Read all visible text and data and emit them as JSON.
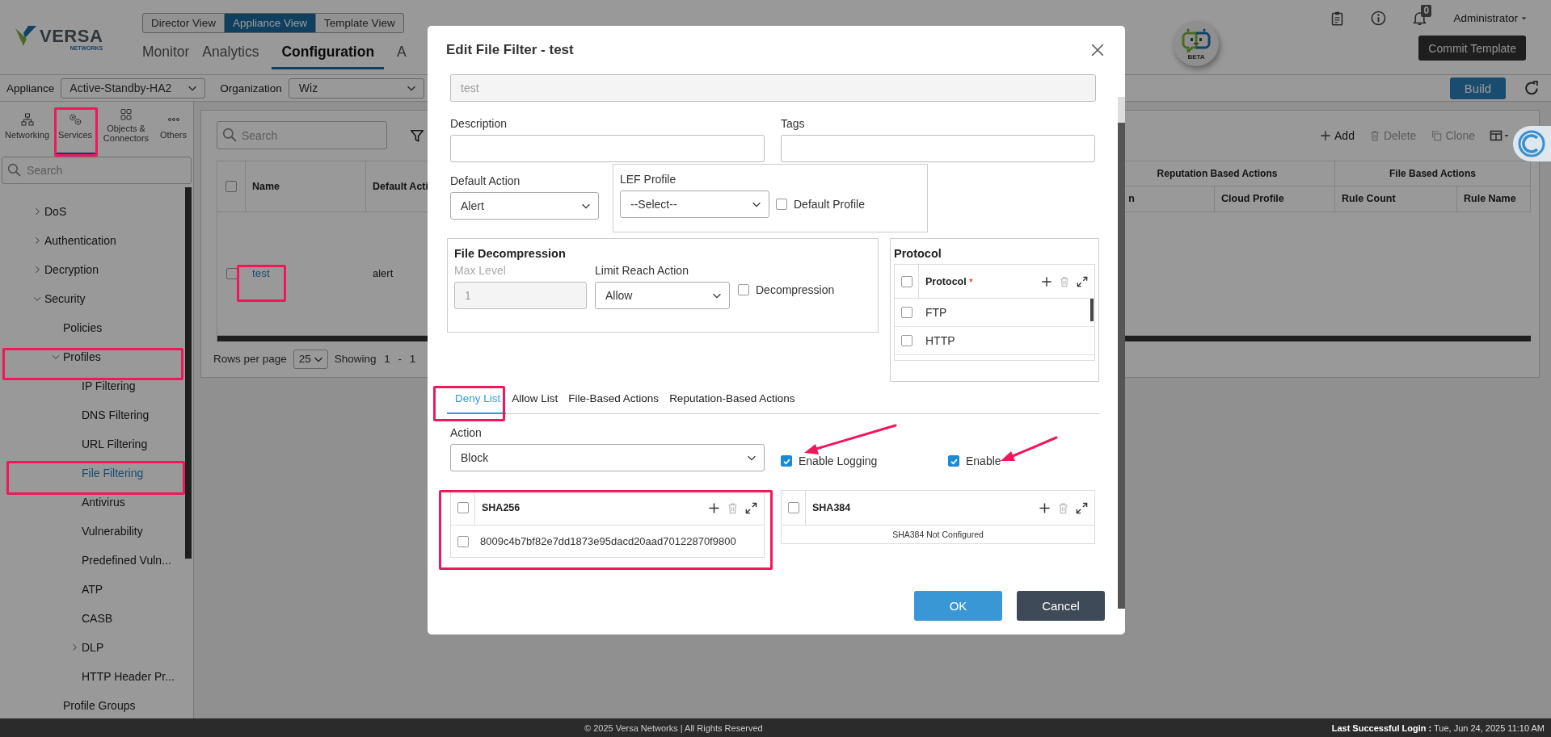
{
  "header": {
    "logo_text": "VERSA",
    "logo_subtext": "NETWORKS",
    "views": [
      {
        "label": "Director View",
        "selected": false
      },
      {
        "label": "Appliance View",
        "selected": true
      },
      {
        "label": "Template View",
        "selected": false
      }
    ],
    "nav": [
      {
        "label": "Monitor",
        "selected": false
      },
      {
        "label": "Analytics",
        "selected": false
      },
      {
        "label": "Configuration",
        "selected": true
      },
      {
        "label": "A",
        "selected": false
      }
    ],
    "beta_label": "BETA",
    "notification_count": "0",
    "user": "Administrator",
    "commit_button": "Commit Template"
  },
  "context_bar": {
    "appliance_label": "Appliance",
    "appliance": "Active-Standby-HA2",
    "organization_label": "Organization",
    "organization": "Wiz",
    "build_button": "Build"
  },
  "sidebar": {
    "tabs": [
      {
        "label": "Networking",
        "selected": false
      },
      {
        "label": "Services",
        "selected": true
      },
      {
        "label": "Objects & Connectors",
        "selected": false
      },
      {
        "label": "Others",
        "selected": false
      }
    ],
    "search_placeholder": "Search",
    "tree": [
      {
        "label": "DoS",
        "kind": "group",
        "expanded": false,
        "selected": false
      },
      {
        "label": "Authentication",
        "kind": "group",
        "expanded": false,
        "selected": false
      },
      {
        "label": "Decryption",
        "kind": "group",
        "expanded": false,
        "selected": false
      },
      {
        "label": "Security",
        "kind": "group",
        "expanded": true,
        "selected": false,
        "children": [
          {
            "label": "Policies",
            "kind": "item",
            "selected": false
          },
          {
            "label": "Profiles",
            "kind": "group",
            "expanded": true,
            "selected": false,
            "children": [
              {
                "label": "IP Filtering",
                "kind": "item",
                "selected": false
              },
              {
                "label": "DNS Filtering",
                "kind": "item",
                "selected": false
              },
              {
                "label": "URL Filtering",
                "kind": "item",
                "selected": false
              },
              {
                "label": "File Filtering",
                "kind": "item",
                "selected": true
              },
              {
                "label": "Antivirus",
                "kind": "item",
                "selected": false
              },
              {
                "label": "Vulnerability",
                "kind": "item",
                "selected": false
              },
              {
                "label": "Predefined Vuln...",
                "kind": "item",
                "selected": false
              },
              {
                "label": "ATP",
                "kind": "item",
                "selected": false
              },
              {
                "label": "CASB",
                "kind": "item",
                "selected": false
              },
              {
                "label": "DLP",
                "kind": "group",
                "expanded": false,
                "selected": false
              },
              {
                "label": "HTTP Header Pr...",
                "kind": "item",
                "selected": false
              }
            ]
          },
          {
            "label": "Profile Groups",
            "kind": "item",
            "selected": false
          }
        ]
      }
    ]
  },
  "content": {
    "search_placeholder": "Search",
    "toolbar": [
      {
        "label": "Add",
        "disabled": false
      },
      {
        "label": "Delete",
        "disabled": true
      },
      {
        "label": "Clone",
        "disabled": true
      }
    ],
    "table": {
      "columns": [
        "Name",
        "Default Acti"
      ],
      "column_groups": [
        {
          "label": "Reputation Based Actions",
          "columns": [
            "n",
            "Cloud Profile"
          ]
        },
        {
          "label": "File Based Actions",
          "columns": [
            "Rule Count",
            "Rule Name"
          ]
        }
      ],
      "header_checked": false,
      "rows": [
        {
          "checked": false,
          "name": "test",
          "default_action": "alert"
        }
      ]
    },
    "pager": {
      "label": "Rows per page",
      "page_size": "25",
      "status": "Showing 1 - 1"
    }
  },
  "dialog": {
    "title": "Edit File Filter - test",
    "name": {
      "value": "test",
      "disabled": true
    },
    "description": {
      "label": "Description"
    },
    "tags": {
      "label": "Tags"
    },
    "default_action": {
      "label": "Default Action",
      "value": "Alert"
    },
    "lef_profile": {
      "label": "LEF Profile",
      "value": "--Select--",
      "default_profile": {
        "label": "Default Profile",
        "checked": false
      }
    },
    "file_decompression": {
      "title": "File Decompression",
      "max_level": {
        "label": "Max Level",
        "value": "1",
        "disabled": true
      },
      "limit_reach_action": {
        "label": "Limit Reach Action",
        "value": "Allow"
      },
      "decompression": {
        "label": "Decompression",
        "checked": false
      }
    },
    "protocol": {
      "title": "Protocol",
      "column": "Protocol",
      "required_mark": "*",
      "header_checked": false,
      "rows": [
        {
          "label": "FTP",
          "checked": false
        },
        {
          "label": "HTTP",
          "checked": false
        }
      ]
    },
    "tabs": [
      {
        "label": "Deny List",
        "selected": true
      },
      {
        "label": "Allow List",
        "selected": false
      },
      {
        "label": "File-Based Actions",
        "selected": false
      },
      {
        "label": "Reputation-Based Actions",
        "selected": false
      }
    ],
    "action": {
      "label": "Action",
      "value": "Block"
    },
    "options": [
      {
        "label": "Enable Logging",
        "checked": true
      },
      {
        "label": "Enable",
        "checked": true
      }
    ],
    "hash_tables": [
      {
        "column": "SHA256",
        "header_checked": false,
        "rows": [
          {
            "value": "8009c4b7bf82e7dd1873e95dacd20aad70122870f9800",
            "checked": false
          }
        ]
      },
      {
        "column": "SHA384",
        "header_checked": false,
        "empty_text": "SHA384 Not Configured"
      }
    ],
    "buttons": [
      {
        "label": "OK",
        "kind": "primary"
      },
      {
        "label": "Cancel",
        "kind": "secondary"
      }
    ]
  },
  "footer": {
    "copyright": "© 2025 Versa Networks | All Rights Reserved",
    "last_login_label": "Last Successful Login :",
    "last_login": "Tue, Jun 24, 2025 11:10 AM"
  }
}
